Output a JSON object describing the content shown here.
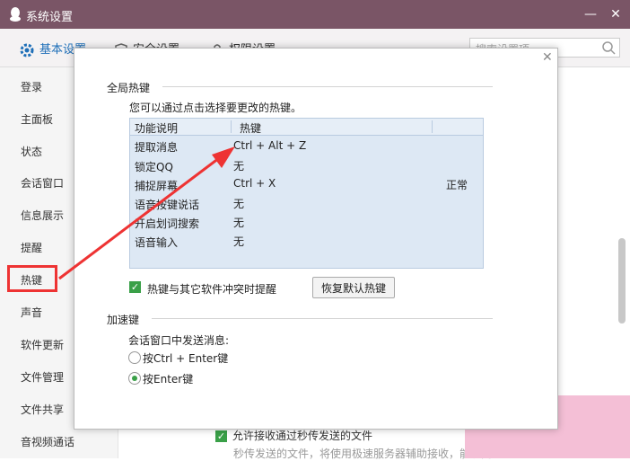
{
  "window": {
    "title": "系统设置",
    "minimize": "—",
    "close": "✕"
  },
  "tabs": [
    {
      "label": "基本设置"
    },
    {
      "label": "安全设置"
    },
    {
      "label": "权限设置"
    }
  ],
  "search": {
    "placeholder": "搜索设置项"
  },
  "sidebar": {
    "items": [
      "登录",
      "主面板",
      "状态",
      "会话窗口",
      "信息展示",
      "提醒",
      "热键",
      "声音",
      "软件更新",
      "文件管理",
      "文件共享",
      "音视频通话"
    ]
  },
  "bg": {
    "check_label": "允许接收通过秒传发送的文件",
    "hint": "秒传发送的文件，将使用极速服务器辅助接收，能提高"
  },
  "dialog": {
    "close": "✕",
    "global_title": "全局热键",
    "hint": "您可以通过点击选择要更改的热键。",
    "table": {
      "headers": [
        "功能说明",
        "热键"
      ],
      "rows": [
        {
          "func": "提取消息",
          "key": "Ctrl + Alt + Z",
          "status": ""
        },
        {
          "func": "锁定QQ",
          "key": "无",
          "status": ""
        },
        {
          "func": "捕捉屏幕",
          "key": "Ctrl + X",
          "status": "正常"
        },
        {
          "func": "语音按键说话",
          "key": "无",
          "status": ""
        },
        {
          "func": "开启划词搜索",
          "key": "无",
          "status": ""
        },
        {
          "func": "语音输入",
          "key": "无",
          "status": ""
        }
      ]
    },
    "conflict_check": "热键与其它软件冲突时提醒",
    "restore_button": "恢复默认热键",
    "accel_title": "加速键",
    "accel_hint": "会话窗口中发送消息:",
    "radio1": "按Ctrl + Enter键",
    "radio2": "按Enter键"
  },
  "colors": {
    "titlebar": "#7a5566",
    "accent": "#1e6fb8",
    "highlight": "#e33333",
    "check": "#3aa048"
  }
}
